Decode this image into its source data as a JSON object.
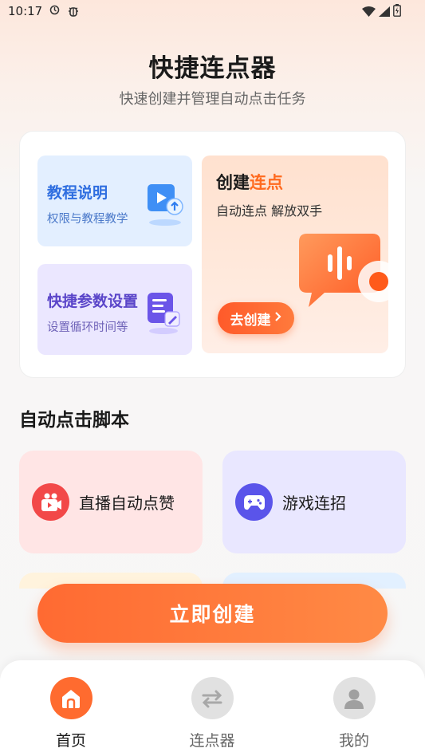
{
  "status_bar": {
    "time": "10:17"
  },
  "header": {
    "title": "快捷连点器",
    "subtitle": "快速创建并管理自动点击任务"
  },
  "features": {
    "tutorial": {
      "title": "教程说明",
      "subtitle": "权限与教程教学",
      "icon": "video-upload-icon"
    },
    "settings": {
      "title": "快捷参数设置",
      "subtitle": "设置循环时间等",
      "icon": "document-edit-icon"
    },
    "create": {
      "title_prefix": "创建",
      "title_accent": "连点",
      "subtitle": "自动连点 解放双手",
      "button_label": "去创建",
      "icon": "chat-bubble-icon"
    }
  },
  "scripts": {
    "title": "自动点击脚本",
    "items": [
      {
        "label": "直播自动点赞",
        "icon": "live-video-icon"
      },
      {
        "label": "游戏连招",
        "icon": "gamepad-icon"
      }
    ]
  },
  "cta": {
    "label": "立即创建"
  },
  "nav": {
    "items": [
      {
        "label": "首页",
        "icon": "home-icon",
        "active": true
      },
      {
        "label": "连点器",
        "icon": "arrows-icon",
        "active": false
      },
      {
        "label": "我的",
        "icon": "user-icon",
        "active": false
      }
    ]
  },
  "colors": {
    "accent": "#ff6a1f",
    "tutorial_blue": "#2f6ee0",
    "settings_purple": "#5a45c9",
    "live_red": "#f24848",
    "game_indigo": "#5a54ea"
  }
}
